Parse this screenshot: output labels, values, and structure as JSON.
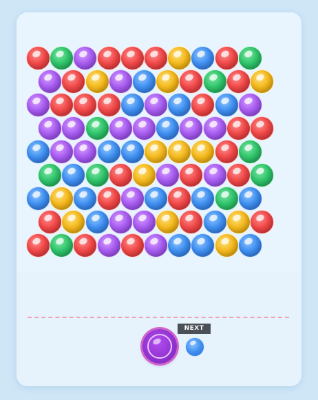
{
  "game": {
    "colors": {
      "red": "#f04848",
      "green": "#2fc46a",
      "purple": "#a75cf0",
      "blue": "#3f8ff0",
      "yellow": "#f3b81c"
    },
    "grid": {
      "rows": [
        [
          "red",
          "green",
          "purple",
          "red",
          "red",
          "red",
          "yellow",
          "blue",
          "red",
          "green"
        ],
        [
          "purple",
          "red",
          "yellow",
          "purple",
          "blue",
          "yellow",
          "red",
          "green",
          "red",
          "yellow"
        ],
        [
          "purple",
          "red",
          "red",
          "red",
          "blue",
          "purple",
          "blue",
          "red",
          "blue",
          "purple"
        ],
        [
          "purple",
          "purple",
          "green",
          "purple",
          "purple",
          "blue",
          "purple",
          "purple",
          "red",
          "red"
        ],
        [
          "blue",
          "purple",
          "purple",
          "blue",
          "blue",
          "yellow",
          "yellow",
          "yellow",
          "red",
          "green"
        ],
        [
          "green",
          "blue",
          "green",
          "red",
          "yellow",
          "purple",
          "red",
          "purple",
          "red",
          "green"
        ],
        [
          "blue",
          "yellow",
          "blue",
          "red",
          "purple",
          "blue",
          "red",
          "blue",
          "green",
          "blue"
        ],
        [
          "red",
          "yellow",
          "blue",
          "purple",
          "purple",
          "yellow",
          "red",
          "blue",
          "yellow",
          "red"
        ],
        [
          "red",
          "green",
          "red",
          "purple",
          "red",
          "purple",
          "blue",
          "blue",
          "yellow",
          "blue"
        ]
      ]
    },
    "shooter": {
      "color": "purple"
    },
    "next": {
      "label": "NEXT",
      "color": "blue"
    }
  }
}
